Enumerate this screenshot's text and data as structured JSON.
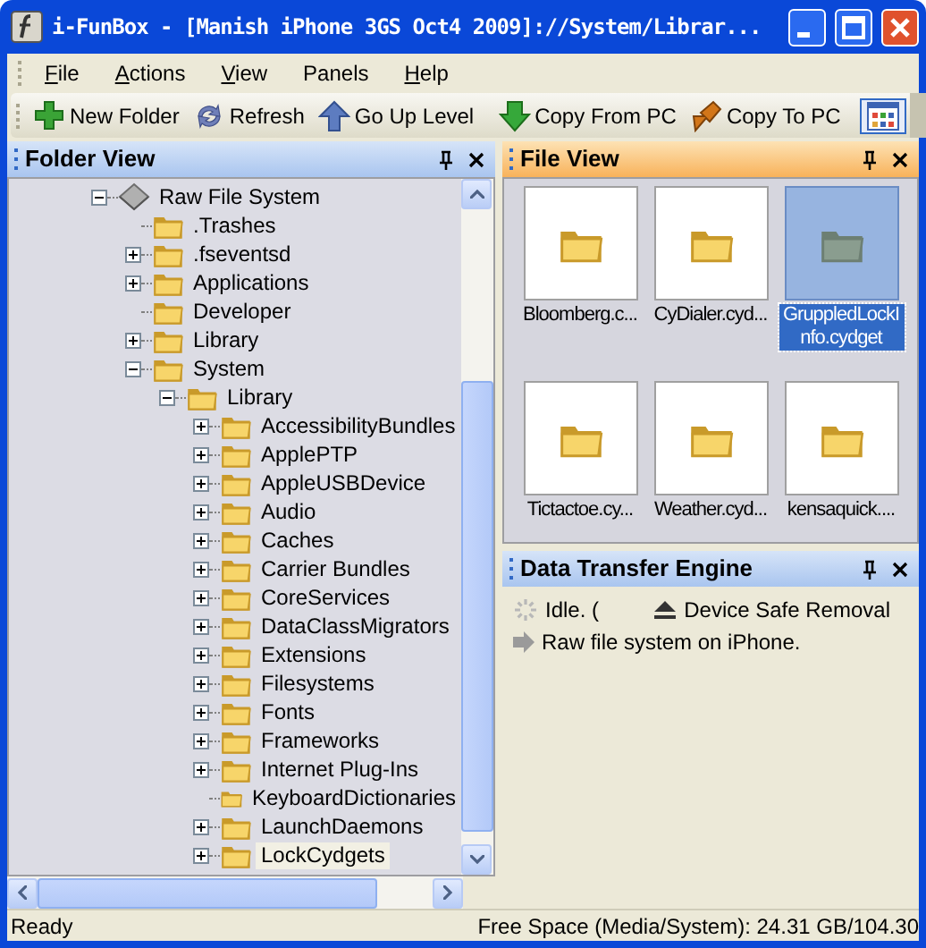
{
  "window": {
    "title": "i-FunBox - [Manish iPhone 3GS Oct4 2009]://System/Librar..."
  },
  "menu": [
    {
      "label": "File",
      "underline": true
    },
    {
      "label": "Actions",
      "underline": true
    },
    {
      "label": "View",
      "underline": true
    },
    {
      "label": "Panels",
      "underline": false
    },
    {
      "label": "Help",
      "underline": true
    }
  ],
  "toolbar": [
    {
      "kind": "new-folder",
      "label": "New Folder"
    },
    {
      "kind": "refresh",
      "label": "Refresh"
    },
    {
      "kind": "up",
      "label": "Go Up Level"
    },
    {
      "kind": "separator"
    },
    {
      "kind": "download",
      "label": "Copy From PC"
    },
    {
      "kind": "upload",
      "label": "Copy To PC"
    },
    {
      "kind": "separator"
    },
    {
      "kind": "view",
      "pressed": true
    }
  ],
  "folder_view": {
    "title": "Folder View",
    "tree": [
      {
        "label": "Raw File System",
        "kind": "drive",
        "expanded": true,
        "selected": false,
        "children": [
          {
            "label": ".Trashes",
            "kind": "folder",
            "selected": false
          },
          {
            "label": ".fseventsd",
            "kind": "folder",
            "expanded": false,
            "selected": false
          },
          {
            "label": "Applications",
            "kind": "folder",
            "expanded": false,
            "selected": false
          },
          {
            "label": "Developer",
            "kind": "folder",
            "selected": false
          },
          {
            "label": "Library",
            "kind": "folder",
            "expanded": false,
            "selected": false
          },
          {
            "label": "System",
            "kind": "folder",
            "expanded": true,
            "selected": false,
            "children": [
              {
                "label": "Library",
                "kind": "folder",
                "expanded": true,
                "selected": false,
                "children": [
                  {
                    "label": "AccessibilityBundles",
                    "kind": "folder",
                    "expanded": false,
                    "selected": false
                  },
                  {
                    "label": "ApplePTP",
                    "kind": "folder",
                    "expanded": false,
                    "selected": false
                  },
                  {
                    "label": "AppleUSBDevice",
                    "kind": "folder",
                    "expanded": false,
                    "selected": false
                  },
                  {
                    "label": "Audio",
                    "kind": "folder",
                    "expanded": false,
                    "selected": false
                  },
                  {
                    "label": "Caches",
                    "kind": "folder",
                    "expanded": false,
                    "selected": false
                  },
                  {
                    "label": "Carrier Bundles",
                    "kind": "folder",
                    "expanded": false,
                    "selected": false
                  },
                  {
                    "label": "CoreServices",
                    "kind": "folder",
                    "expanded": false,
                    "selected": false
                  },
                  {
                    "label": "DataClassMigrators",
                    "kind": "folder",
                    "expanded": false,
                    "selected": false
                  },
                  {
                    "label": "Extensions",
                    "kind": "folder",
                    "expanded": false,
                    "selected": false
                  },
                  {
                    "label": "Filesystems",
                    "kind": "folder",
                    "expanded": false,
                    "selected": false
                  },
                  {
                    "label": "Fonts",
                    "kind": "folder",
                    "expanded": false,
                    "selected": false
                  },
                  {
                    "label": "Frameworks",
                    "kind": "folder",
                    "expanded": false,
                    "selected": false
                  },
                  {
                    "label": "Internet Plug-Ins",
                    "kind": "folder",
                    "expanded": false,
                    "selected": false
                  },
                  {
                    "label": "KeyboardDictionaries",
                    "kind": "folder",
                    "selected": false
                  },
                  {
                    "label": "LaunchDaemons",
                    "kind": "folder",
                    "expanded": false,
                    "selected": false
                  },
                  {
                    "label": "LockCydgets",
                    "kind": "folder",
                    "expanded": false,
                    "selected": true
                  }
                ]
              }
            ]
          }
        ]
      }
    ]
  },
  "file_view": {
    "title": "File View",
    "files": [
      {
        "name": "Bloomberg.c...",
        "selected": false
      },
      {
        "name": "CyDialer.cyd...",
        "selected": false
      },
      {
        "name": "GruppledLockInfo.cydget",
        "selected": true
      },
      {
        "name": "Tictactoe.cy...",
        "selected": false
      },
      {
        "name": "Weather.cyd...",
        "selected": false
      },
      {
        "name": "kensaquick....",
        "selected": false
      }
    ]
  },
  "transfer": {
    "title": "Data Transfer Engine",
    "status": "Idle. (",
    "button": "Device Safe Removal",
    "message": "Raw file system on iPhone."
  },
  "status_bar": {
    "left": "Ready",
    "right": "Free Space (Media/System): 24.31 GB/104.30"
  }
}
